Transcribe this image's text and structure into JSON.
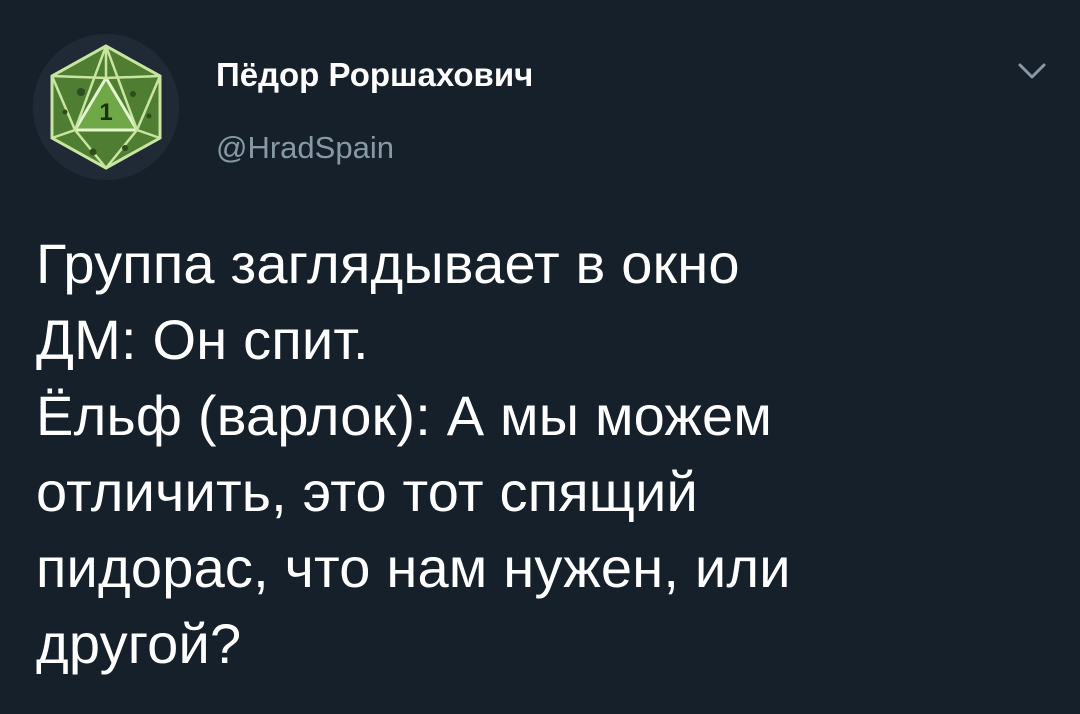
{
  "author": {
    "display_name": "Пёдор Роршахович",
    "handle": "@HradSpain",
    "avatar_icon": "d20-dice-icon",
    "avatar_die_face": "1",
    "avatar_color": "#5a8a3a"
  },
  "menu": {
    "icon": "chevron-down-icon"
  },
  "tweet": {
    "text": "Группа заглядывает в окно\nДМ: Он спит.\nЁльф (варлок): А мы можем\nотличить, это тот спящий\nпидорас, что нам нужен, или\nдругой?"
  },
  "theme": {
    "background": "#15202b",
    "text": "#ffffff",
    "secondary_text": "#8899a6"
  }
}
